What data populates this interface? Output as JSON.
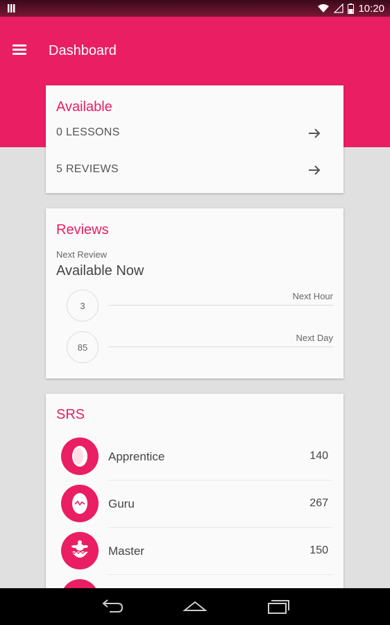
{
  "status_bar": {
    "time": "10:20",
    "icons": [
      "notification-icon",
      "wifi-icon",
      "signal-icon",
      "battery-icon"
    ]
  },
  "app_bar": {
    "title": "Dashboard",
    "menu_icon": "menu-icon"
  },
  "available": {
    "title": "Available",
    "items": [
      {
        "label": "0 LESSONS",
        "icon": "arrow-right-icon"
      },
      {
        "label": "5 REVIEWS",
        "icon": "arrow-right-icon"
      }
    ]
  },
  "reviews": {
    "title": "Reviews",
    "next_review_label": "Next Review",
    "next_review_value": "Available Now",
    "forecast": [
      {
        "count": "3",
        "label": "Next Hour"
      },
      {
        "count": "85",
        "label": "Next Day"
      }
    ]
  },
  "srs": {
    "title": "SRS",
    "items": [
      {
        "name": "Apprentice",
        "count": "140",
        "icon": "egg-icon"
      },
      {
        "name": "Guru",
        "count": "267",
        "icon": "cracked-egg-icon"
      },
      {
        "name": "Master",
        "count": "150",
        "icon": "hatching-turtle-icon"
      }
    ]
  },
  "nav_bar": {
    "icons": [
      "back-icon",
      "home-icon",
      "recents-icon"
    ]
  },
  "colors": {
    "accent": "#e91e63",
    "background": "#e0e0e0",
    "card": "#fafafa"
  }
}
